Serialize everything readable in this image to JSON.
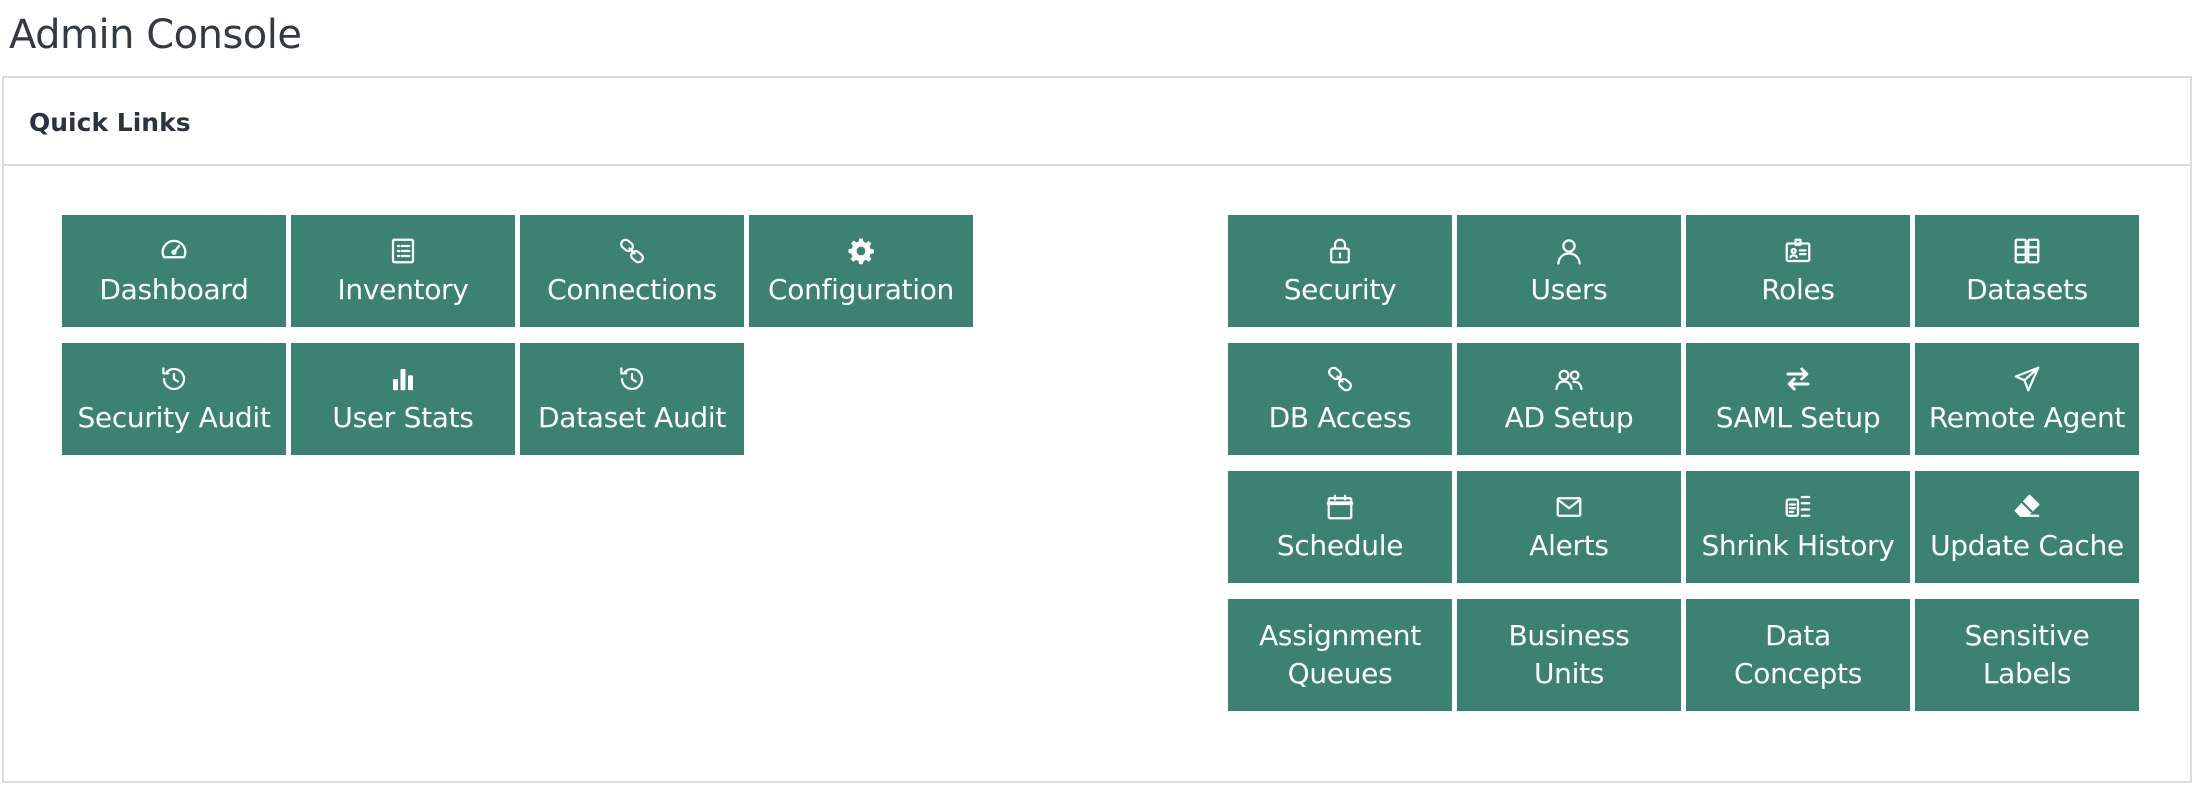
{
  "page_title": "Admin Console",
  "panel": {
    "title": "Quick Links"
  },
  "colors": {
    "tile_bg": "#3c8270",
    "tile_text": "#ffffff",
    "border": "#dcdcdc"
  },
  "left_tiles": [
    {
      "label": "Dashboard",
      "icon": "speedometer-icon"
    },
    {
      "label": "Inventory",
      "icon": "list-icon"
    },
    {
      "label": "Connections",
      "icon": "link-icon"
    },
    {
      "label": "Configuration",
      "icon": "gear-icon"
    },
    {
      "label": "Security Audit",
      "icon": "history-icon"
    },
    {
      "label": "User Stats",
      "icon": "bar-chart-icon"
    },
    {
      "label": "Dataset Audit",
      "icon": "history-icon"
    }
  ],
  "right_tiles": [
    {
      "label": "Security",
      "icon": "lock-icon"
    },
    {
      "label": "Users",
      "icon": "user-icon"
    },
    {
      "label": "Roles",
      "icon": "id-badge-icon"
    },
    {
      "label": "Datasets",
      "icon": "database-icon"
    },
    {
      "label": "DB Access",
      "icon": "link-icon"
    },
    {
      "label": "AD Setup",
      "icon": "users-icon"
    },
    {
      "label": "SAML Setup",
      "icon": "exchange-icon"
    },
    {
      "label": "Remote Agent",
      "icon": "paper-plane-icon"
    },
    {
      "label": "Schedule",
      "icon": "calendar-icon"
    },
    {
      "label": "Alerts",
      "icon": "envelope-icon"
    },
    {
      "label": "Shrink History",
      "icon": "history-list-icon"
    },
    {
      "label": "Update Cache",
      "icon": "eraser-icon"
    },
    {
      "label_lines": [
        "Assignment",
        "Queues"
      ]
    },
    {
      "label_lines": [
        "Business",
        "Units"
      ]
    },
    {
      "label_lines": [
        "Data",
        "Concepts"
      ]
    },
    {
      "label_lines": [
        "Sensitive",
        "Labels"
      ]
    }
  ]
}
